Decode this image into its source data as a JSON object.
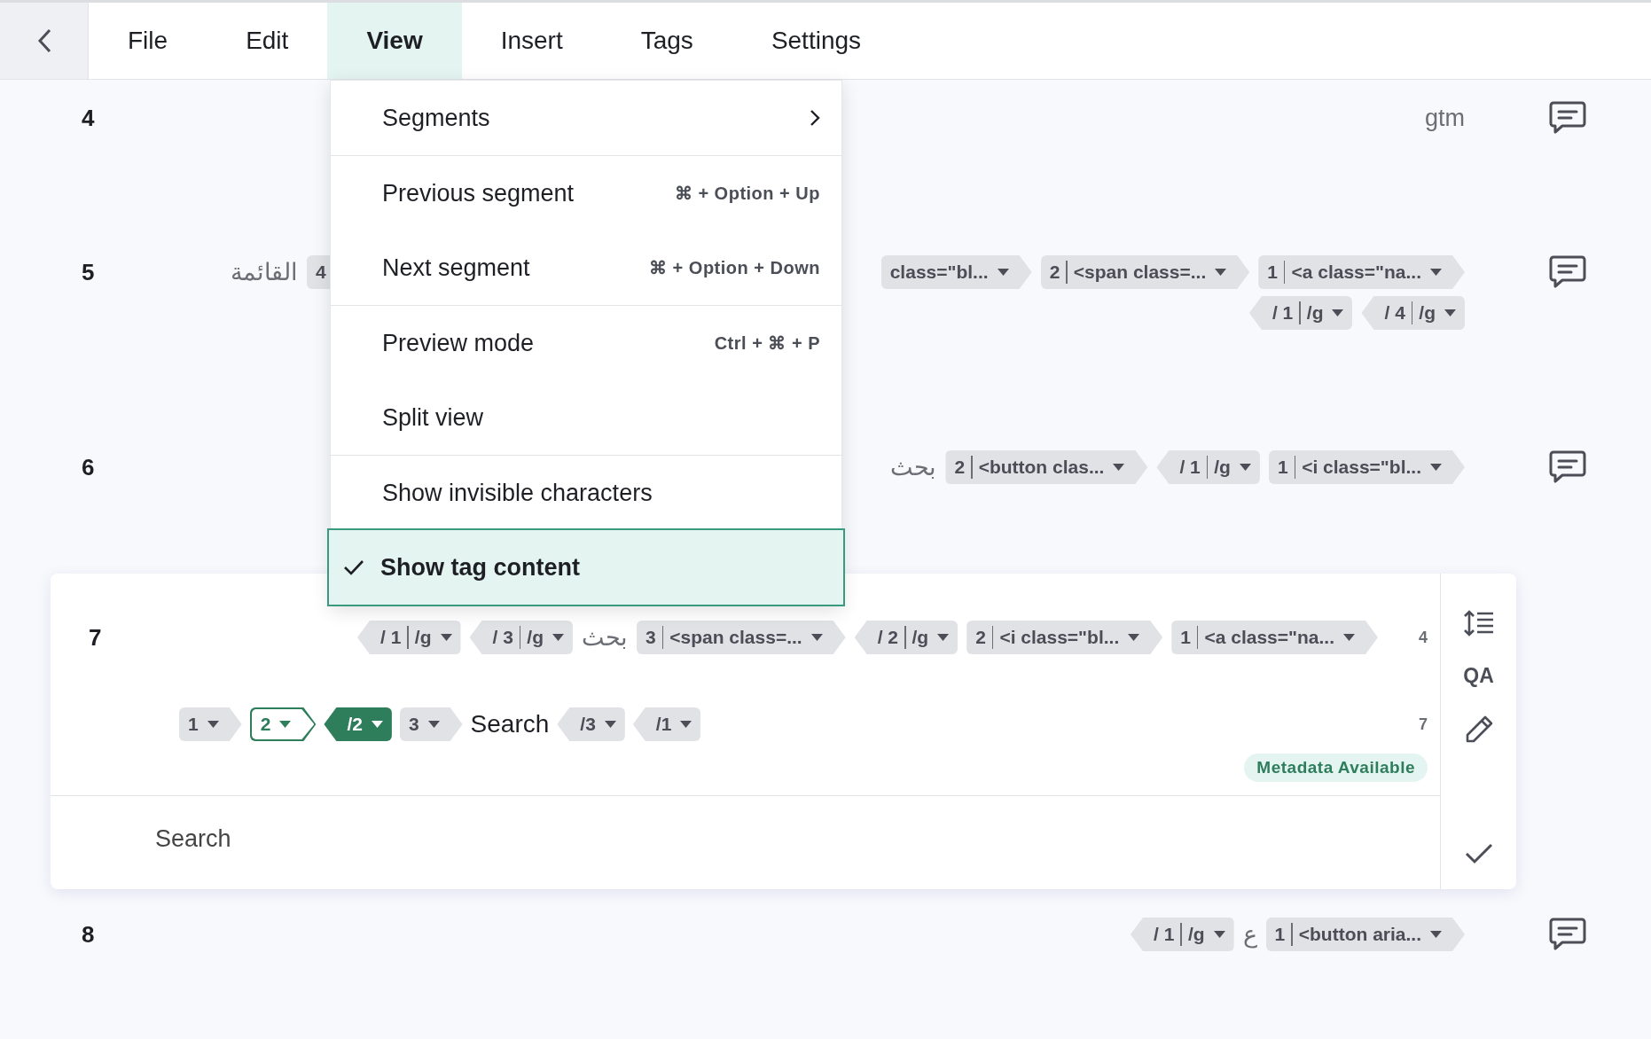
{
  "tabs": [
    {
      "label": "File",
      "selected": false
    },
    {
      "label": "Edit",
      "selected": false
    },
    {
      "label": "View",
      "selected": true
    },
    {
      "label": "Insert",
      "selected": false
    },
    {
      "label": "Tags",
      "selected": false
    },
    {
      "label": "Settings",
      "selected": false
    }
  ],
  "rows": [
    {
      "number": "4",
      "lines": [
        {
          "trailing": [
            {
              "kind": "text",
              "text": "gtm"
            }
          ]
        }
      ]
    },
    {
      "number": "5",
      "lines": [
        {
          "leading": [
            {
              "kind": "text",
              "text": "القائمة"
            },
            {
              "kind": "open",
              "number": "4"
            }
          ],
          "trailing": [
            {
              "kind": "open",
              "text": "class=\"bl..."
            },
            {
              "kind": "open",
              "number": "2",
              "text": "<span class=..."
            },
            {
              "kind": "open",
              "number": "1",
              "text": "<a class=\"na..."
            }
          ]
        },
        {
          "trailing": [
            {
              "kind": "close",
              "number": "/ 1",
              "text": "/g"
            },
            {
              "kind": "close",
              "number": "/ 4",
              "text": "/g"
            }
          ]
        }
      ]
    },
    {
      "number": "6",
      "lines": [
        {
          "trailing": [
            {
              "kind": "text",
              "text": "بحث"
            },
            {
              "kind": "open",
              "number": "2",
              "text": "<button clas..."
            },
            {
              "kind": "close",
              "number": "/ 1",
              "text": "/g"
            },
            {
              "kind": "open",
              "number": "1",
              "text": "<i class=\"bl..."
            }
          ]
        }
      ]
    }
  ],
  "active_segment": {
    "number": "7",
    "source": {
      "length": "4",
      "items": [
        {
          "kind": "close",
          "number": "/ 1",
          "text": "/g"
        },
        {
          "kind": "close",
          "number": "/ 3",
          "text": "/g"
        },
        {
          "kind": "text",
          "text": "بحث"
        },
        {
          "kind": "open",
          "number": "3",
          "text": "<span class=..."
        },
        {
          "kind": "close",
          "number": "/ 2",
          "text": "/g"
        },
        {
          "kind": "open",
          "number": "2",
          "text": "<i class=\"bl..."
        },
        {
          "kind": "open",
          "number": "1",
          "text": "<a class=\"na..."
        }
      ]
    },
    "target": {
      "length": "7",
      "items": [
        {
          "kind": "open",
          "number": "1",
          "focused": false,
          "selected": false
        },
        {
          "kind": "open",
          "number": "2",
          "focused": true,
          "selected": false
        },
        {
          "kind": "close",
          "number": "/2",
          "focused": false,
          "selected": true
        },
        {
          "kind": "open",
          "number": "3",
          "focused": false,
          "selected": false
        },
        {
          "kind": "text",
          "text": "Search"
        },
        {
          "kind": "close",
          "number": "/3",
          "focused": false,
          "selected": false
        },
        {
          "kind": "close",
          "number": "/1",
          "focused": false,
          "selected": false
        }
      ]
    },
    "badge": "Metadata Available",
    "editor": {
      "value": "Search"
    },
    "qa_label": "QA"
  },
  "last_rows": [
    {
      "number": "8",
      "lines": [
        {
          "trailing": [
            {
              "kind": "close",
              "number": "/ 1",
              "text": "/g"
            },
            {
              "kind": "text",
              "text": "ع"
            },
            {
              "kind": "open",
              "number": "1",
              "text": "<button aria..."
            }
          ]
        }
      ]
    }
  ],
  "menu": {
    "items": [
      {
        "kind": "submenu",
        "label": "Segments",
        "checked": false,
        "selected": false
      },
      {
        "kind": "separator"
      },
      {
        "kind": "item",
        "label": "Previous segment",
        "shortcut": "⌘ + Option + Up",
        "checked": false,
        "selected": false
      },
      {
        "kind": "item",
        "label": "Next segment",
        "shortcut": "⌘ + Option + Down",
        "checked": false,
        "selected": false
      },
      {
        "kind": "separator"
      },
      {
        "kind": "item",
        "label": "Preview mode",
        "shortcut": "Ctrl + ⌘ + P",
        "checked": false,
        "selected": false
      },
      {
        "kind": "item",
        "label": "Split view",
        "checked": false,
        "selected": false
      },
      {
        "kind": "separator"
      },
      {
        "kind": "item",
        "label": "Show invisible characters",
        "checked": false,
        "selected": false
      },
      {
        "kind": "item",
        "label": "Show tag content",
        "checked": true,
        "selected": true
      }
    ]
  }
}
